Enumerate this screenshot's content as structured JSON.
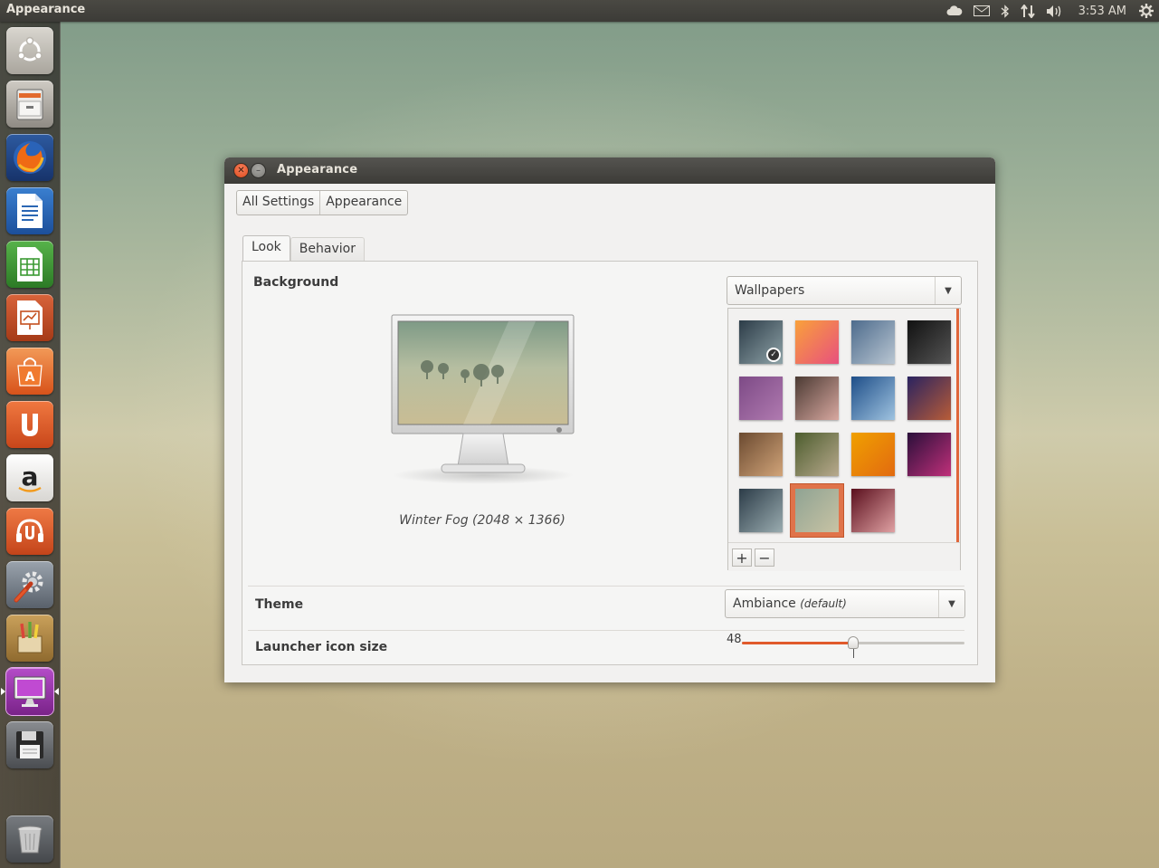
{
  "top_panel": {
    "app_title": "Appearance",
    "clock": "3:53 AM",
    "indicators": [
      "cloud-icon",
      "mail-icon",
      "bluetooth-icon",
      "network-icon",
      "volume-icon",
      "gear-icon"
    ]
  },
  "launcher": {
    "items": [
      {
        "name": "dash-home",
        "icon": "ubuntu-logo-icon"
      },
      {
        "name": "files",
        "icon": "file-cabinet-icon"
      },
      {
        "name": "firefox",
        "icon": "firefox-icon"
      },
      {
        "name": "libreoffice-writer",
        "icon": "writer-icon"
      },
      {
        "name": "libreoffice-calc",
        "icon": "calc-icon"
      },
      {
        "name": "libreoffice-impress",
        "icon": "impress-icon"
      },
      {
        "name": "ubuntu-software-center",
        "icon": "shopping-bag-icon"
      },
      {
        "name": "ubuntu-one",
        "icon": "ubuntu-one-icon"
      },
      {
        "name": "amazon",
        "icon": "amazon-icon"
      },
      {
        "name": "ubuntu-one-music",
        "icon": "music-icon"
      },
      {
        "name": "system-settings",
        "icon": "settings-icon"
      },
      {
        "name": "text-editor",
        "icon": "pencils-icon"
      },
      {
        "name": "appearance",
        "icon": "monitor-icon",
        "active": true
      },
      {
        "name": "removable-drive",
        "icon": "floppy-icon"
      },
      {
        "name": "trash",
        "icon": "trash-icon"
      }
    ]
  },
  "window": {
    "title": "Appearance",
    "breadcrumb": [
      "All Settings",
      "Appearance"
    ],
    "tabs": [
      {
        "label": "Look",
        "active": true
      },
      {
        "label": "Behavior",
        "active": false
      }
    ],
    "background": {
      "label": "Background",
      "source": "Wallpapers",
      "current_name": "Winter Fog (2048 × 1366)",
      "add_label": "+",
      "remove_label": "−",
      "thumbnails": [
        {
          "name": "thumb-1",
          "colors": [
            "#2c3c48",
            "#8fa3a8"
          ],
          "slideshow": true
        },
        {
          "name": "thumb-2",
          "colors": [
            "#f9a13a",
            "#e8507e"
          ]
        },
        {
          "name": "thumb-3",
          "colors": [
            "#4d6b8c",
            "#b9c6d2"
          ]
        },
        {
          "name": "thumb-4",
          "colors": [
            "#111111",
            "#555555"
          ]
        },
        {
          "name": "thumb-5",
          "colors": [
            "#7d4a86",
            "#b07ab0"
          ]
        },
        {
          "name": "thumb-6",
          "colors": [
            "#4b3a33",
            "#d8a8a0"
          ]
        },
        {
          "name": "thumb-7",
          "colors": [
            "#1e4e88",
            "#9fc3e0"
          ]
        },
        {
          "name": "thumb-8",
          "colors": [
            "#2a2360",
            "#b85c38"
          ]
        },
        {
          "name": "thumb-9",
          "colors": [
            "#6b4a30",
            "#d1a479"
          ]
        },
        {
          "name": "thumb-10",
          "colors": [
            "#4d5d2e",
            "#b8a98d"
          ]
        },
        {
          "name": "thumb-11",
          "colors": [
            "#f0a000",
            "#e26a10"
          ]
        },
        {
          "name": "thumb-12",
          "colors": [
            "#2a0f3a",
            "#c0307a"
          ]
        },
        {
          "name": "thumb-13",
          "colors": [
            "#2c3c48",
            "#9aacb0"
          ]
        },
        {
          "name": "thumb-14",
          "colors": [
            "#8fa393",
            "#c8c3a4"
          ],
          "selected": true
        },
        {
          "name": "thumb-15",
          "colors": [
            "#5a0f1d",
            "#e0a1a3"
          ]
        }
      ]
    },
    "theme": {
      "label": "Theme",
      "value": "Ambiance",
      "value_note": "(default)"
    },
    "launcher_icon_size": {
      "label": "Launcher icon size",
      "value": "48",
      "fraction": 0.5
    }
  },
  "colors": {
    "accent": "#e05a2b",
    "panel": "#3c3b37"
  }
}
